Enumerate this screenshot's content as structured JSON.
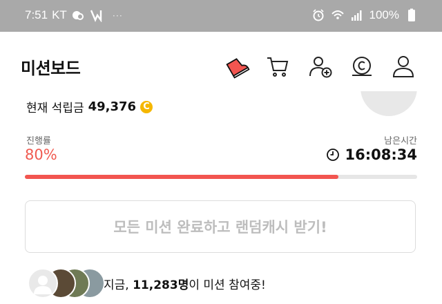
{
  "status_bar": {
    "time": "7:51",
    "carrier": "KT",
    "battery": "100%",
    "icons": [
      "cloud-icon",
      "vpn-icon",
      "more-dots-icon",
      "alarm-icon",
      "wifi-icon",
      "signal-icon",
      "battery-icon"
    ]
  },
  "header": {
    "title": "미션보드",
    "icons": [
      "sneaker-icon",
      "cart-icon",
      "add-user-icon",
      "coin-icon",
      "profile-icon"
    ]
  },
  "savings": {
    "label": "현재 석립금",
    "amount": "49,376",
    "coin_symbol": "C",
    "coin_color": "#f5b700"
  },
  "progress": {
    "label": "진행률",
    "percent_text": "80%",
    "value": 0.8,
    "remaining_label": "남은시간",
    "remaining_time": "16:08:34",
    "accent_color": "#f25550"
  },
  "reward_button": {
    "label": "모든 미션 완료하고 랜덤캐시 받기!"
  },
  "participants": {
    "prefix": "지금, ",
    "count": "11,283명",
    "suffix": "이 미션 참여중!"
  }
}
